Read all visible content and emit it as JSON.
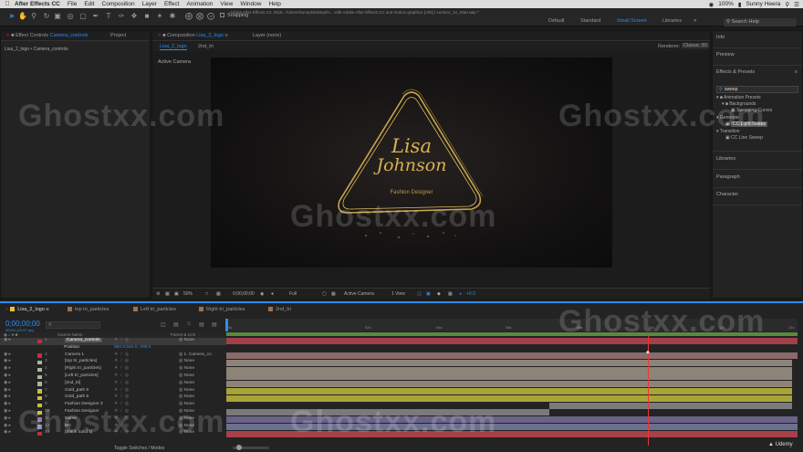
{
  "menubar": {
    "app_name": "After Effects CC",
    "items": [
      "File",
      "Edit",
      "Composition",
      "Layer",
      "Effect",
      "Animation",
      "View",
      "Window",
      "Help"
    ],
    "status": "Sunny Heera",
    "battery": "100%"
  },
  "toolbar": {
    "snapping_label": "Snapping",
    "doc_path": "Adobe After Effects CC 2018 - /Users/SunnyDesktop/H... with Adobe After Effects CC and motion graphics [All3] / Lecture_10_Start.aep *",
    "workspaces": [
      "Default",
      "Standard",
      "Small Screen",
      "Libraries"
    ],
    "active_workspace": "Small Screen",
    "search_placeholder": "Search Help"
  },
  "left_panel": {
    "tab_effect_controls": "Effect Controls",
    "tab_effect_controls_target": "Camera_controls",
    "tab_project": "Project",
    "breadcrumb": "Lisa_2_logo • Camera_controls"
  },
  "comp_panel": {
    "tab_label": "Composition",
    "tab_target": "Lisa_2_logo",
    "layer_tab": "Layer (none)",
    "subtabs": [
      "Lisa_2_logo",
      "2nd_tri"
    ],
    "renderer_label": "Renderer:",
    "renderer_value": "Classic 3D",
    "active_camera": "Active Camera",
    "logo_line1": "Lisa",
    "logo_line2": "Johnson",
    "logo_tagline": "Fashion Designer"
  },
  "viewer_bar": {
    "zoom": "50%",
    "time": "0;00;00;00",
    "resolution": "Full",
    "view": "Active Camera",
    "views": "1 View",
    "offset": "+0.0"
  },
  "right_panel": {
    "sections": [
      "Info",
      "Preview",
      "Effects & Presets",
      "Libraries",
      "Paragraph",
      "Character"
    ],
    "search_value": "sweep",
    "tree": [
      {
        "label": "Animation Presets",
        "level": 0
      },
      {
        "label": "Backgrounds",
        "level": 1
      },
      {
        "label": "Sweeping Curves",
        "level": 2
      },
      {
        "label": "Generate",
        "level": 0
      },
      {
        "label": "CC Light Sweep",
        "level": 1,
        "selected": true
      },
      {
        "label": "Transition",
        "level": 0
      },
      {
        "label": "CC Line Sweep",
        "level": 1
      }
    ]
  },
  "timeline": {
    "tabs": [
      {
        "label": "Lisa_2_logo",
        "active": true,
        "color": "#e8c23a"
      },
      {
        "label": "top tri_particles",
        "color": "#a07050"
      },
      {
        "label": "Left tri_particles",
        "color": "#a07050"
      },
      {
        "label": "Right tri_particles",
        "color": "#a07050"
      },
      {
        "label": "2nd_tri",
        "color": "#a07050"
      }
    ],
    "timecode": "0;00;00;00",
    "timecode_sub": "00000 (29.97 fps)",
    "col_source": "Source Name",
    "col_parent": "Parent & Link",
    "ruler_ticks": [
      "0s",
      "02s",
      "04s",
      "06s",
      "08s",
      "10s",
      "12s",
      "14s"
    ],
    "toggle_label": "Toggle Switches / Modes",
    "brand": "Udemy",
    "layers": [
      {
        "num": "1",
        "name": "Camera_controls",
        "color": "#c03040",
        "parent": "None",
        "selected": true
      },
      {
        "num": "",
        "name": "Position",
        "color": "",
        "parent": "",
        "value": "960.0,540.0,-300.0",
        "property": true
      },
      {
        "num": "2",
        "name": "Camera 1",
        "color": "#c03040",
        "parent": "1. Camera_co"
      },
      {
        "num": "3",
        "name": "[top tri_particles]",
        "color": "#a8b5a0",
        "parent": "None"
      },
      {
        "num": "4",
        "name": "[Right tri_particles]",
        "color": "#a8b5a0",
        "parent": "None"
      },
      {
        "num": "5",
        "name": "[Left tri_particles]",
        "color": "#a8b5a0",
        "parent": "None"
      },
      {
        "num": "6",
        "name": "[2nd_tri]",
        "color": "#a8b5a0",
        "parent": "None"
      },
      {
        "num": "7",
        "name": "Gold_path 6",
        "color": "#c8c040",
        "parent": "None"
      },
      {
        "num": "8",
        "name": "Gold_path 5",
        "color": "#c8c040",
        "parent": "None"
      },
      {
        "num": "9",
        "name": "Fashion Designer 3",
        "color": "#c8c040",
        "parent": "None"
      },
      {
        "num": "10",
        "name": "Fashion Designer",
        "color": "#c8c040",
        "parent": "None"
      },
      {
        "num": "11",
        "name": "Name",
        "color": "#a070c0",
        "parent": "None"
      },
      {
        "num": "12",
        "name": "BG",
        "color": "#8090c0",
        "parent": "None"
      },
      {
        "num": "13",
        "name": "[Black Solid 1]",
        "color": "#c03040",
        "parent": "None"
      }
    ]
  },
  "watermark": "Ghostxx.com"
}
